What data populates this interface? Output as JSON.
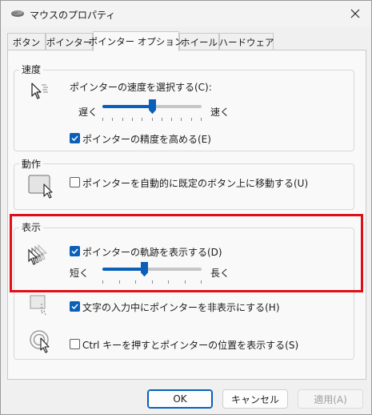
{
  "window": {
    "title": "マウスのプロパティ"
  },
  "tabs": [
    {
      "label": "ボタン",
      "active": false
    },
    {
      "label": "ポインター",
      "active": false
    },
    {
      "label": "ポインター オプション",
      "active": true
    },
    {
      "label": "ホイール",
      "active": false
    },
    {
      "label": "ハードウェア",
      "active": false
    }
  ],
  "speed": {
    "group_title": "速度",
    "select_label": "ポインターの速度を選択する(C):",
    "slow_label": "遅く",
    "fast_label": "速く",
    "slider_fraction": 0.5,
    "precision_label": "ポインターの精度を高める(E)",
    "precision_checked": true
  },
  "motion": {
    "group_title": "動作",
    "snapto_label": "ポインターを自動的に既定のボタン上に移動する(U)",
    "snapto_checked": false
  },
  "visibility": {
    "group_title": "表示",
    "trails_label": "ポインターの軌跡を表示する(D)",
    "trails_checked": true,
    "short_label": "短く",
    "long_label": "長く",
    "trails_fraction": 0.42,
    "hide_typing_label": "文字の入力中にポインターを非表示にする(H)",
    "hide_typing_checked": true,
    "ctrl_label": "Ctrl キーを押すとポインターの位置を表示する(S)",
    "ctrl_checked": false
  },
  "buttons": {
    "ok": "OK",
    "cancel": "キャンセル",
    "apply": "適用(A)"
  },
  "colors": {
    "accent": "#0a5fb8",
    "highlight": "#e00e17"
  }
}
